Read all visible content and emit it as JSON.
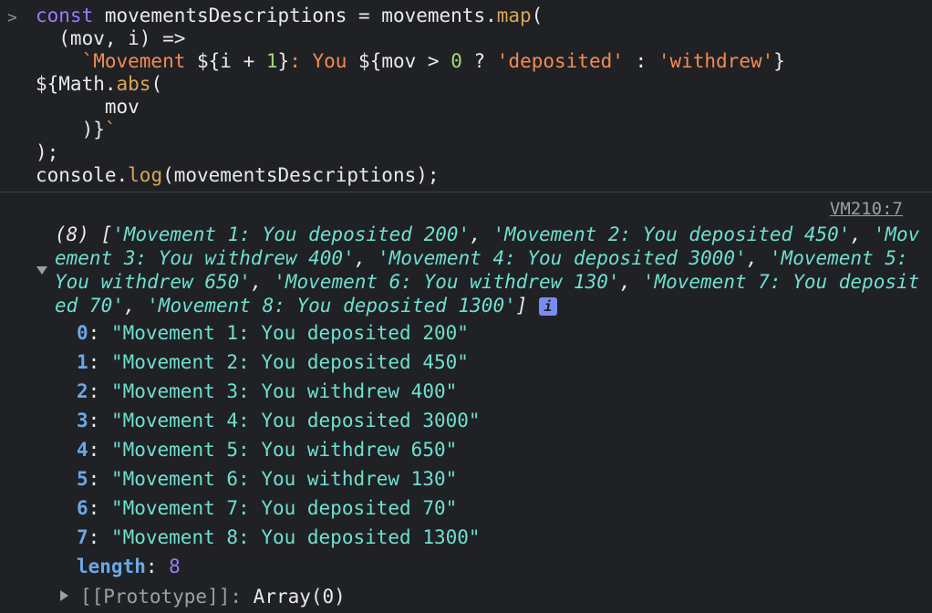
{
  "prompt_symbol": ">",
  "code": {
    "l1_const": "const",
    "l1_var": " movementsDescriptions = movements.",
    "l1_map": "map",
    "l1_paren": "(",
    "l2": "  (mov, i) =>",
    "l3_tick": "    `Movement ",
    "l3_a": "${i + ",
    "l3_one": "1",
    "l3_b": "}",
    "l3_you": ": You ",
    "l3_c": "${mov > ",
    "l3_zero": "0",
    "l3_q": " ? ",
    "l3_dep": "'deposited'",
    "l3_colon": " : ",
    "l3_wd": "'withdrew'",
    "l3_close": "}",
    "l4_a": "${Math.",
    "l4_abs": "abs",
    "l4_paren": "(",
    "l5": "      mov",
    "l6_a": "    )}",
    "l6_tick": "`",
    "l7": ");",
    "l8_a": "console.",
    "l8_log": "log",
    "l8_b": "(movementsDescriptions);"
  },
  "source_link": "VM210:7",
  "summary": {
    "prefix": "(8) [",
    "items": [
      "'Movement 1: You deposited 200'",
      "'Movement 2: You deposited 450'",
      "'Movement 3: You withdrew 400'",
      "'Movement 4: You deposited 3000'",
      "'Movement 5: You withdrew 650'",
      "'Movement 6: You withdrew 130'",
      "'Movement 7: You deposited 70'",
      "'Movement 8: You deposited 1300'"
    ],
    "suffix": "]",
    "info_badge": "i"
  },
  "entries": [
    {
      "index": "0",
      "value": "\"Movement 1: You deposited 200\""
    },
    {
      "index": "1",
      "value": "\"Movement 2: You deposited 450\""
    },
    {
      "index": "2",
      "value": "\"Movement 3: You withdrew 400\""
    },
    {
      "index": "3",
      "value": "\"Movement 4: You deposited 3000\""
    },
    {
      "index": "4",
      "value": "\"Movement 5: You withdrew 650\""
    },
    {
      "index": "5",
      "value": "\"Movement 6: You withdrew 130\""
    },
    {
      "index": "6",
      "value": "\"Movement 7: You deposited 70\""
    },
    {
      "index": "7",
      "value": "\"Movement 8: You deposited 1300\""
    }
  ],
  "length_key": "length",
  "length_value": "8",
  "prototype_key": "[[Prototype]]",
  "prototype_value": "Array(0)"
}
